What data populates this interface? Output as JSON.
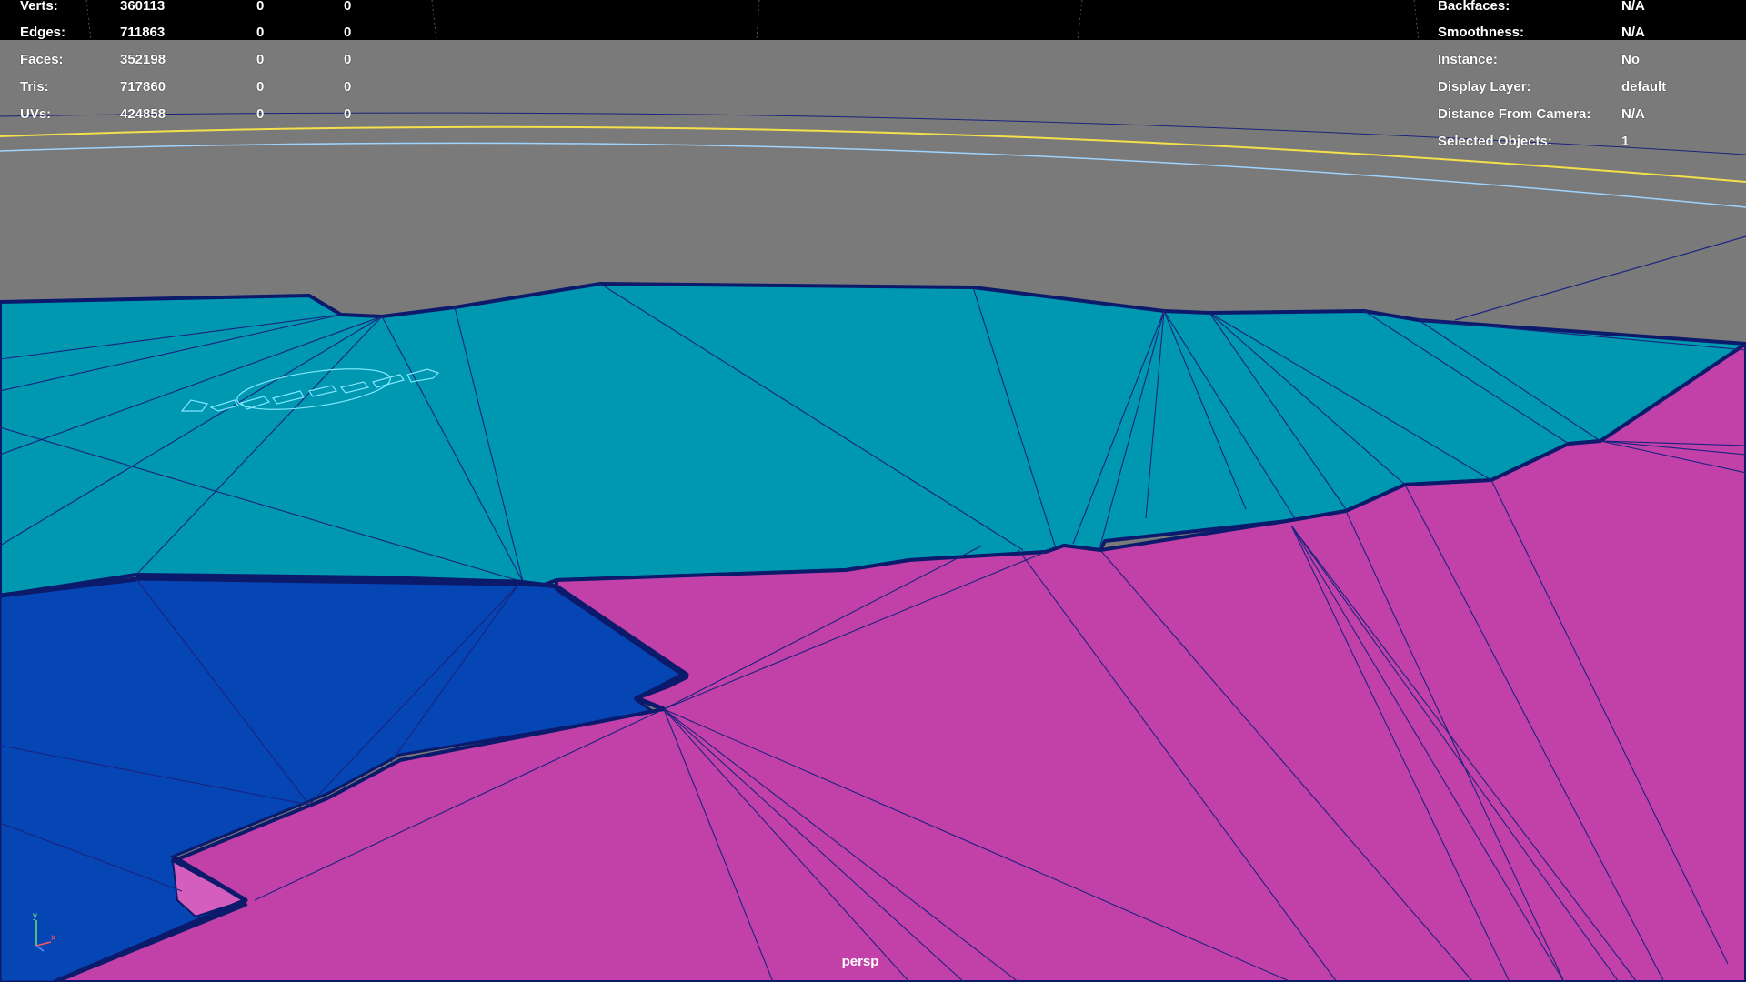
{
  "viewport": {
    "camera": "persp",
    "colors": {
      "background": "#7a7a7a",
      "hud_band": "#000000",
      "cyan_surface": "#0097b0",
      "blue_surface": "#0645b4",
      "magenta_surface": "#c241a8",
      "wire": "#1a237e",
      "selection_highlight": "#7fe8ff",
      "curve_yellow": "#f4e04a",
      "curve_blue": "#9fd4ff"
    }
  },
  "hud_left": {
    "rows": [
      {
        "label": "Verts:",
        "value": "360113",
        "sel": "0",
        "uv": "0"
      },
      {
        "label": "Edges:",
        "value": "711863",
        "sel": "0",
        "uv": "0"
      },
      {
        "label": "Faces:",
        "value": "352198",
        "sel": "0",
        "uv": "0"
      },
      {
        "label": "Tris:",
        "value": "717860",
        "sel": "0",
        "uv": "0"
      },
      {
        "label": "UVs:",
        "value": "424858",
        "sel": "0",
        "uv": "0"
      }
    ]
  },
  "hud_right": {
    "rows": [
      {
        "label": "Backfaces:",
        "value": "N/A"
      },
      {
        "label": "Smoothness:",
        "value": "N/A"
      },
      {
        "label": "Instance:",
        "value": "No"
      },
      {
        "label": "Display Layer:",
        "value": "default"
      },
      {
        "label": "Distance From Camera:",
        "value": "N/A"
      },
      {
        "label": "Selected Objects:",
        "value": "1"
      }
    ]
  },
  "axis_gizmo": {
    "y_label": "y",
    "x_label": "x",
    "icon": "axis-gizmo-icon"
  }
}
